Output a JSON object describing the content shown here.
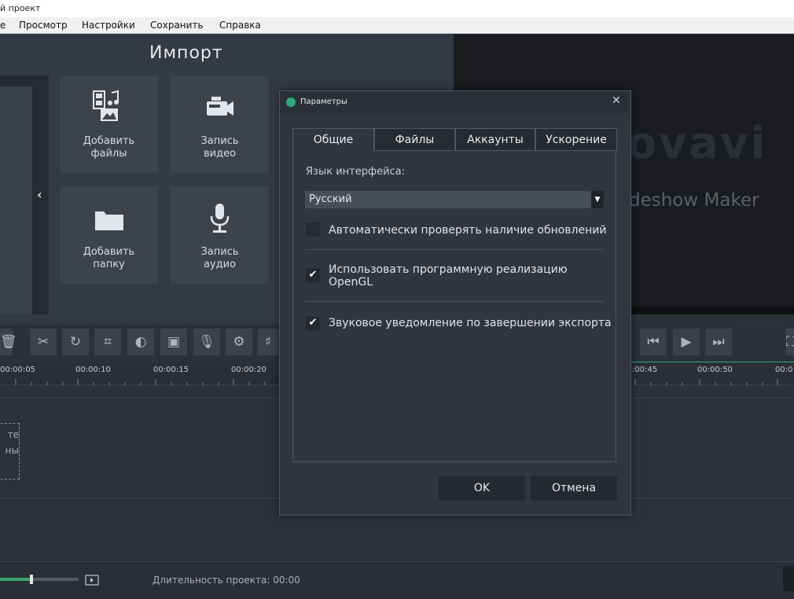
{
  "window": {
    "title": "й проект"
  },
  "menu": {
    "items": [
      "е",
      "Просмотр",
      "Настройки",
      "Сохранить",
      "Справка"
    ]
  },
  "import": {
    "title": "Импорт",
    "tiles": [
      {
        "line1": "Добавить",
        "line2": "файлы",
        "icon": "add-files-icon"
      },
      {
        "line1": "Запись",
        "line2": "видео",
        "icon": "video-camera-icon"
      },
      {
        "line1": "Добавить",
        "line2": "папку",
        "icon": "folder-icon"
      },
      {
        "line1": "Запись",
        "line2": "аудио",
        "icon": "microphone-icon"
      }
    ]
  },
  "preview": {
    "logo": "ovavi",
    "subtitle": "deshow Maker"
  },
  "ruler": {
    "ticks": [
      "00:00:05",
      "00:00:10",
      "00:00:15",
      "00:00:20",
      ":00:45",
      "00:00:50",
      "00:0"
    ]
  },
  "timeline": {
    "drop_line1": "те",
    "drop_line2": "ны"
  },
  "bottom": {
    "duration_label": "Длительность проекта:",
    "duration_value": "00:00",
    "zoom_level": 0.4
  },
  "dialog": {
    "title": "Параметры",
    "tabs": [
      "Общие",
      "Файлы",
      "Аккаунты",
      "Ускорение"
    ],
    "active_tab": "Общие",
    "language_label": "Язык интерфейса:",
    "language_value": "Русский",
    "options": [
      {
        "label": "Автоматически проверять наличие обновлений",
        "checked": false
      },
      {
        "label_line1": "Использовать программную реализацию",
        "label_line2": "OpenGL",
        "checked": true
      },
      {
        "label": "Звуковое уведомление по завершении экспорта",
        "checked": true
      }
    ],
    "ok_label": "OK",
    "cancel_label": "Отмена"
  },
  "colors": {
    "accent": "#3aa36b",
    "dialog_bg": "#31363e",
    "panel_bg": "#343a44"
  }
}
